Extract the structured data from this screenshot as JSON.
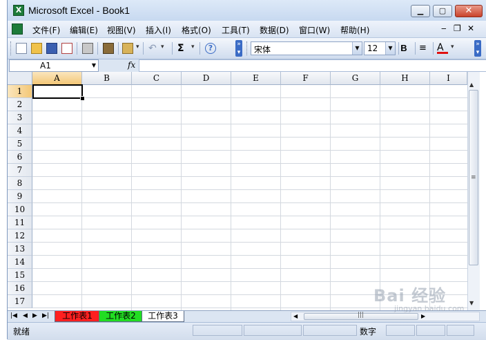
{
  "window": {
    "title": "Microsoft Excel - Book1",
    "min_glyph": "▁",
    "max_glyph": "▢",
    "close_glyph": "✕"
  },
  "menu": {
    "items": [
      "文件(F)",
      "编辑(E)",
      "视图(V)",
      "插入(I)",
      "格式(O)",
      "工具(T)",
      "数据(D)",
      "窗口(W)",
      "帮助(H)"
    ],
    "doc_min": "‒",
    "doc_restore": "❐",
    "doc_close": "✕"
  },
  "toolbar": {
    "font": "宋体",
    "size": "12",
    "bold": "B",
    "sum": "Σ",
    "font_color": "A",
    "help": "?"
  },
  "formula": {
    "name_box": "A1",
    "fx": "fx",
    "value": ""
  },
  "grid": {
    "columns": [
      "A",
      "B",
      "C",
      "D",
      "E",
      "F",
      "G",
      "H",
      "I"
    ],
    "rows": [
      "1",
      "2",
      "3",
      "4",
      "5",
      "6",
      "7",
      "8",
      "9",
      "10",
      "11",
      "12",
      "13",
      "14",
      "15",
      "16",
      "17"
    ],
    "active_cell": "A1"
  },
  "sheets": [
    {
      "name": "工作表1",
      "color": "#ff2020"
    },
    {
      "name": "工作表2",
      "color": "#22dd22"
    },
    {
      "name": "工作表3",
      "color": "#ffffff"
    }
  ],
  "status": {
    "ready": "就绪",
    "mode": "数字"
  },
  "watermark": {
    "brand": "Bai 经验",
    "url": "jingyan.baidu.com"
  }
}
